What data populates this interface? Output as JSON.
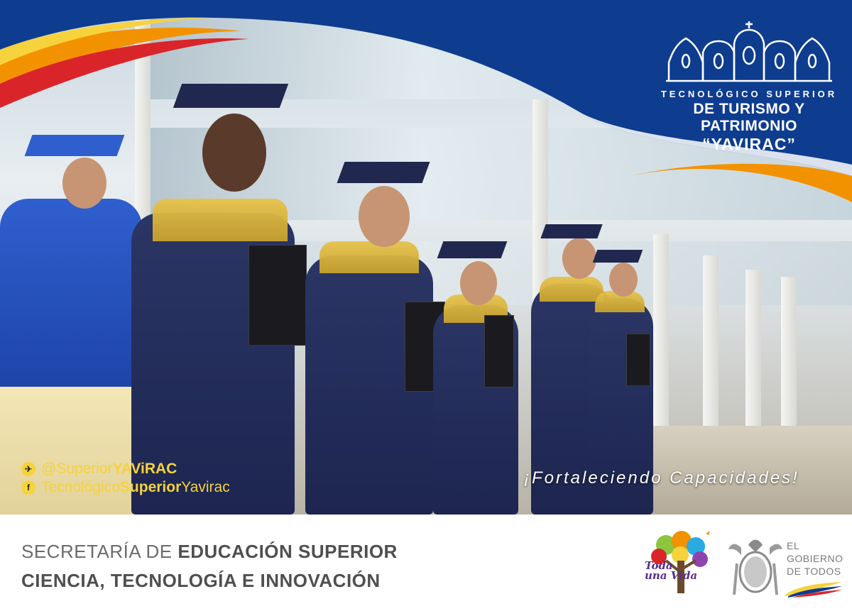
{
  "logo": {
    "line1": "TECNOLÓGICO SUPERIOR",
    "line2": "DE TURISMO Y PATRIMONIO",
    "line3": "“YAVIRAC”"
  },
  "social": {
    "twitter_prefix": "@Superior",
    "twitter_bold": "YAViRAC",
    "facebook_prefix": "Tecnológico",
    "facebook_bold": "Superior",
    "facebook_suffix": "Yavirac"
  },
  "slogan": "¡Fortaleciendo Capacidades!",
  "secretaria": {
    "line1_light": "SECRETARÍA DE ",
    "line1_bold": "EDUCACIÓN SUPERIOR",
    "line2": "CIENCIA, TECNOLOGÍA E INNOVACIÓN"
  },
  "partners": {
    "tree_text_1": "Toda",
    "tree_text_2": "una",
    "tree_text_3": "Vida",
    "gov_1": "EL",
    "gov_2": "GOBIERNO",
    "gov_3": "DE TODOS"
  },
  "colors": {
    "banner_blue": "#0e3c8f",
    "banner_orange": "#f39200",
    "social_yellow": "#f6d23d",
    "gown_navy": "#1d2550",
    "stole_gold": "#e6c34a"
  }
}
